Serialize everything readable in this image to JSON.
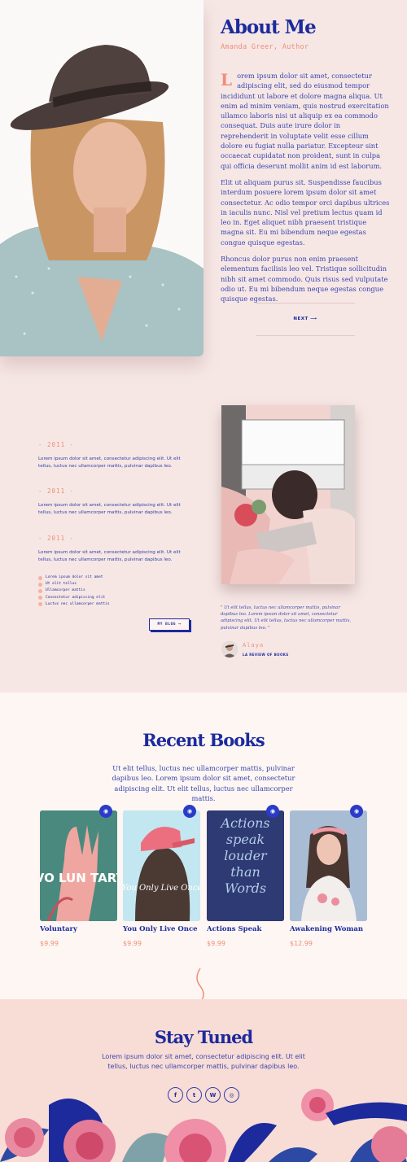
{
  "about": {
    "title": "About Me",
    "subtitle": "Amanda Greer, Author",
    "dropcap": "L",
    "p1": "orem ipsum dolor sit amet, consectetur adipiscing elit, sed do eiusmod tempor incididunt ut labore et dolore magna aliqua. Ut enim ad minim veniam, quis nostrud exercitation ullamco laboris nisi ut aliquip ex ea commodo consequat. Duis aute irure dolor in reprehenderit in voluptate velit esse cillum dolore eu fugiat nulla pariatur. Excepteur sint occaecat cupidatat non proident, sunt in culpa qui officia deserunt mollit anim id est laborum.",
    "p2": "Elit ut aliquam purus sit. Suspendisse faucibus interdum posuere lorem ipsum dolor sit amet consectetur. Ac odio tempor orci dapibus ultrices in iaculis nunc. Nisl vel pretium lectus quam id leo in. Eget aliquet nibh praesent tristique magna sit. Eu mi bibendum neque egestas congue quisque egestas.",
    "p3": "Rhoncus dolor purus non enim praesent elementum facilisis leo vel. Tristique sollicitudin nibh sit amet commodo. Quis risus sed vulputate odio ut. Eu mi bibendum neque egestas congue quisque egestas.",
    "next_label": "NEXT ⟶"
  },
  "timeline": [
    {
      "year": "- 2011 -",
      "text": "Lorem ipsum dolor sit amet, consectetur adipiscing elit. Ut elit tellus, luctus nec ullamcorper mattis, pulvinar dapibus leo."
    },
    {
      "year": "- 2011 -",
      "text": "Lorem ipsum dolor sit amet, consectetur adipiscing elit. Ut elit tellus, luctus nec ullamcorper mattis, pulvinar dapibus leo."
    },
    {
      "year": "- 2011 -",
      "text": "Lorem ipsum dolor sit amet, consectetur adipiscing elit. Ut elit tellus, luctus nec ullamcorper mattis, pulvinar dapibus leo."
    }
  ],
  "bullets": [
    "Lorem ipsum dolor sit amet",
    "Ut elit tellus",
    "Ullamcorper mattis",
    "Consectetur adipiscing elit",
    "Luctus nec ullamcorper mattis"
  ],
  "blog_button": "MY BLOG ⟶",
  "testimonial": {
    "quote": "\" Ut elit tellus, luctus nec ullamcorper mattis, pulvinar dapibus leo. Lorem ipsum dolor sit amet, consectetur adipiscing elit. Ut elit tellus, luctus nec ullamcorper mattis, pulvinar dapibus leo. \"",
    "name": "Alaya",
    "role": "LA REVIEW OF BOOKS"
  },
  "recent_books": {
    "title": "Recent Books",
    "subtitle": "Ut elit tellus, luctus nec ullamcorper mattis, pulvinar dapibus leo. Lorem ipsum dolor sit amet, consectetur adipiscing elit. Ut elit tellus, luctus nec ullamcorper mattis.",
    "items": [
      {
        "name": "Voluntary",
        "price": "$9.99",
        "cover_text": "VO LUN TARY"
      },
      {
        "name": "You Only Live Once",
        "price": "$9.99",
        "cover_text": "You Only Live Once"
      },
      {
        "name": "Actions Speak",
        "price": "$9.99",
        "cover_text": "Actions speak louder than Words"
      },
      {
        "name": "Awakening Woman",
        "price": "$12.99",
        "cover_text": ""
      }
    ]
  },
  "stay_tuned": {
    "title": "Stay Tuned",
    "subtitle": "Lorem ipsum dolor sit amet, consectetur adipiscing elit. Ut elit tellus, luctus nec ullamcorper mattis, pulvinar dapibus leo.",
    "social": [
      "f",
      "t",
      "W",
      "◎"
    ]
  },
  "icons": {
    "view": "eye-icon",
    "social": [
      "facebook-icon",
      "twitter-icon",
      "wordpress-icon",
      "instagram-icon"
    ]
  },
  "colors": {
    "background": "#f6e7e5",
    "brand_blue": "#1c2a9c",
    "accent_coral": "#f08d79",
    "books_bg": "#fdf6f2",
    "footer_bg": "#f8dcd6"
  }
}
